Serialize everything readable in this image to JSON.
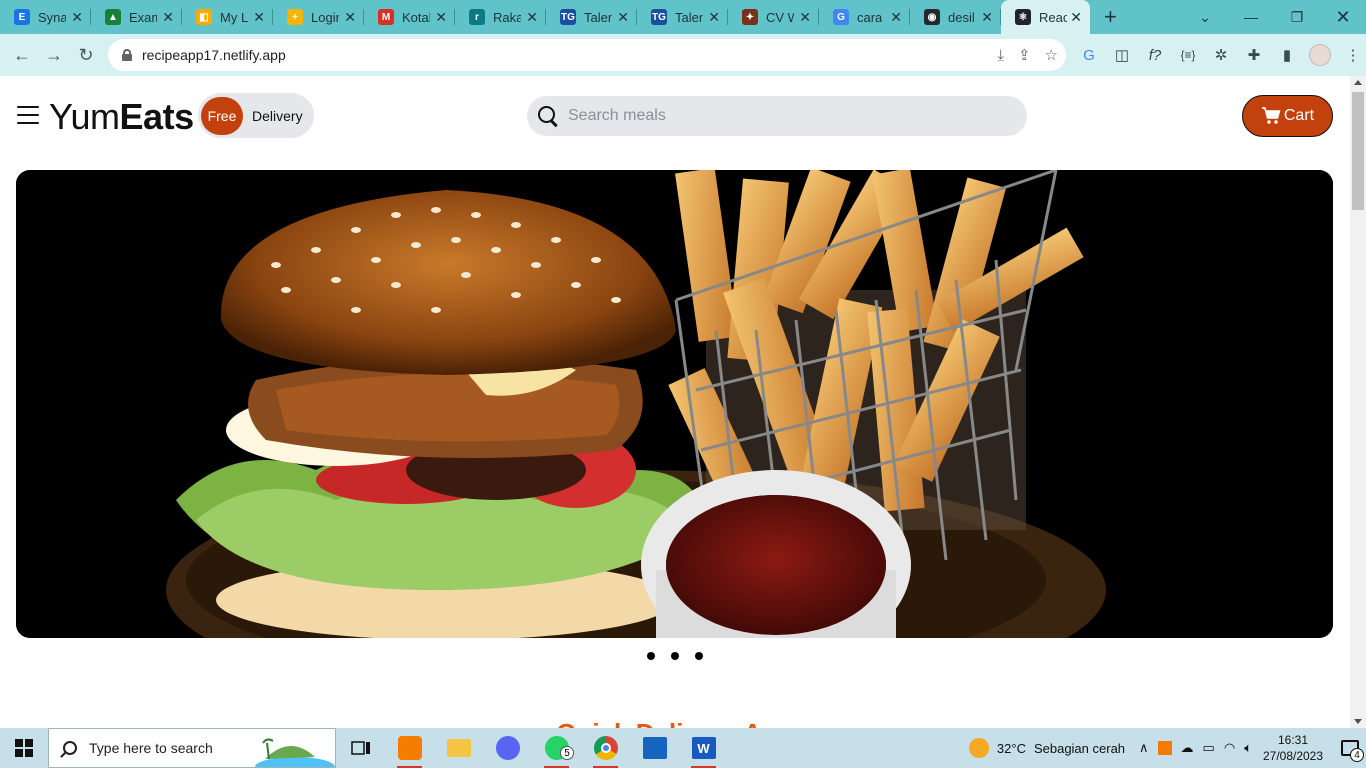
{
  "browser": {
    "tabs": [
      {
        "label": "Synapse",
        "fav": "E",
        "color": "#1a73e8"
      },
      {
        "label": "Exam",
        "fav": "▲",
        "color": "#188038"
      },
      {
        "label": "My L",
        "fav": "◧",
        "color": "#f9ab00"
      },
      {
        "label": "Login",
        "fav": "+",
        "color": "#f4b400"
      },
      {
        "label": "Kotak",
        "fav": "M",
        "color": "#d93025"
      },
      {
        "label": "Rakamin",
        "fav": "r",
        "color": "#0b7a85"
      },
      {
        "label": "Talent",
        "fav": "TG",
        "color": "#1a4fa0"
      },
      {
        "label": "Talent",
        "fav": "TG",
        "color": "#1a4fa0"
      },
      {
        "label": "CV W",
        "fav": "✦",
        "color": "#7a2f1b"
      },
      {
        "label": "cara",
        "fav": "G",
        "color": "#4285f4"
      },
      {
        "label": "desil",
        "fav": "◉",
        "color": "#24292f"
      },
      {
        "label": "React",
        "fav": "⚛",
        "color": "#20232a",
        "active": true
      }
    ],
    "url": "recipeapp17.netlify.app"
  },
  "app": {
    "logo_light": "Yum",
    "logo_bold": "Eats",
    "toggle_free": "Free",
    "toggle_delivery": "Delivery",
    "search_placeholder": "Search meals",
    "cart_label": "Cart",
    "section_title": "Quick Delivery App",
    "carousel_dots": 3,
    "colors": {
      "accent": "#c2410c",
      "title": "#ea580c"
    }
  },
  "taskbar": {
    "search_placeholder": "Type here to search",
    "weather_temp": "32°C",
    "weather_desc": "Sebagian cerah",
    "time": "16:31",
    "date": "27/08/2023",
    "whatsapp_badge": "5",
    "notifications": "4"
  }
}
